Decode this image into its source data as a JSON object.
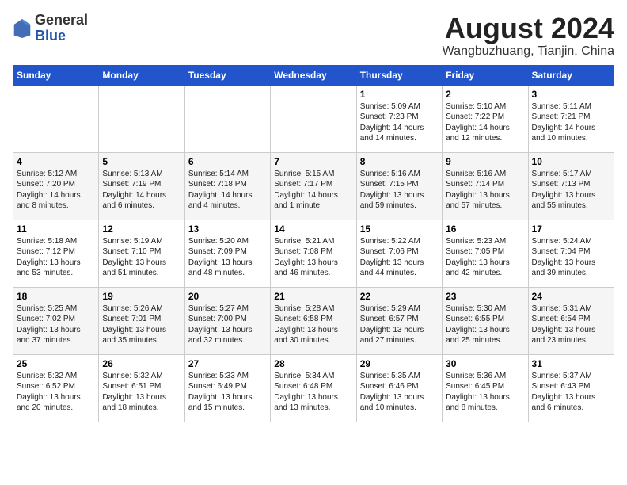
{
  "header": {
    "logo_general": "General",
    "logo_blue": "Blue",
    "month_title": "August 2024",
    "location": "Wangbuzhuang, Tianjin, China"
  },
  "weekdays": [
    "Sunday",
    "Monday",
    "Tuesday",
    "Wednesday",
    "Thursday",
    "Friday",
    "Saturday"
  ],
  "weeks": [
    [
      {
        "day": "",
        "content": ""
      },
      {
        "day": "",
        "content": ""
      },
      {
        "day": "",
        "content": ""
      },
      {
        "day": "",
        "content": ""
      },
      {
        "day": "1",
        "content": "Sunrise: 5:09 AM\nSunset: 7:23 PM\nDaylight: 14 hours\nand 14 minutes."
      },
      {
        "day": "2",
        "content": "Sunrise: 5:10 AM\nSunset: 7:22 PM\nDaylight: 14 hours\nand 12 minutes."
      },
      {
        "day": "3",
        "content": "Sunrise: 5:11 AM\nSunset: 7:21 PM\nDaylight: 14 hours\nand 10 minutes."
      }
    ],
    [
      {
        "day": "4",
        "content": "Sunrise: 5:12 AM\nSunset: 7:20 PM\nDaylight: 14 hours\nand 8 minutes."
      },
      {
        "day": "5",
        "content": "Sunrise: 5:13 AM\nSunset: 7:19 PM\nDaylight: 14 hours\nand 6 minutes."
      },
      {
        "day": "6",
        "content": "Sunrise: 5:14 AM\nSunset: 7:18 PM\nDaylight: 14 hours\nand 4 minutes."
      },
      {
        "day": "7",
        "content": "Sunrise: 5:15 AM\nSunset: 7:17 PM\nDaylight: 14 hours\nand 1 minute."
      },
      {
        "day": "8",
        "content": "Sunrise: 5:16 AM\nSunset: 7:15 PM\nDaylight: 13 hours\nand 59 minutes."
      },
      {
        "day": "9",
        "content": "Sunrise: 5:16 AM\nSunset: 7:14 PM\nDaylight: 13 hours\nand 57 minutes."
      },
      {
        "day": "10",
        "content": "Sunrise: 5:17 AM\nSunset: 7:13 PM\nDaylight: 13 hours\nand 55 minutes."
      }
    ],
    [
      {
        "day": "11",
        "content": "Sunrise: 5:18 AM\nSunset: 7:12 PM\nDaylight: 13 hours\nand 53 minutes."
      },
      {
        "day": "12",
        "content": "Sunrise: 5:19 AM\nSunset: 7:10 PM\nDaylight: 13 hours\nand 51 minutes."
      },
      {
        "day": "13",
        "content": "Sunrise: 5:20 AM\nSunset: 7:09 PM\nDaylight: 13 hours\nand 48 minutes."
      },
      {
        "day": "14",
        "content": "Sunrise: 5:21 AM\nSunset: 7:08 PM\nDaylight: 13 hours\nand 46 minutes."
      },
      {
        "day": "15",
        "content": "Sunrise: 5:22 AM\nSunset: 7:06 PM\nDaylight: 13 hours\nand 44 minutes."
      },
      {
        "day": "16",
        "content": "Sunrise: 5:23 AM\nSunset: 7:05 PM\nDaylight: 13 hours\nand 42 minutes."
      },
      {
        "day": "17",
        "content": "Sunrise: 5:24 AM\nSunset: 7:04 PM\nDaylight: 13 hours\nand 39 minutes."
      }
    ],
    [
      {
        "day": "18",
        "content": "Sunrise: 5:25 AM\nSunset: 7:02 PM\nDaylight: 13 hours\nand 37 minutes."
      },
      {
        "day": "19",
        "content": "Sunrise: 5:26 AM\nSunset: 7:01 PM\nDaylight: 13 hours\nand 35 minutes."
      },
      {
        "day": "20",
        "content": "Sunrise: 5:27 AM\nSunset: 7:00 PM\nDaylight: 13 hours\nand 32 minutes."
      },
      {
        "day": "21",
        "content": "Sunrise: 5:28 AM\nSunset: 6:58 PM\nDaylight: 13 hours\nand 30 minutes."
      },
      {
        "day": "22",
        "content": "Sunrise: 5:29 AM\nSunset: 6:57 PM\nDaylight: 13 hours\nand 27 minutes."
      },
      {
        "day": "23",
        "content": "Sunrise: 5:30 AM\nSunset: 6:55 PM\nDaylight: 13 hours\nand 25 minutes."
      },
      {
        "day": "24",
        "content": "Sunrise: 5:31 AM\nSunset: 6:54 PM\nDaylight: 13 hours\nand 23 minutes."
      }
    ],
    [
      {
        "day": "25",
        "content": "Sunrise: 5:32 AM\nSunset: 6:52 PM\nDaylight: 13 hours\nand 20 minutes."
      },
      {
        "day": "26",
        "content": "Sunrise: 5:32 AM\nSunset: 6:51 PM\nDaylight: 13 hours\nand 18 minutes."
      },
      {
        "day": "27",
        "content": "Sunrise: 5:33 AM\nSunset: 6:49 PM\nDaylight: 13 hours\nand 15 minutes."
      },
      {
        "day": "28",
        "content": "Sunrise: 5:34 AM\nSunset: 6:48 PM\nDaylight: 13 hours\nand 13 minutes."
      },
      {
        "day": "29",
        "content": "Sunrise: 5:35 AM\nSunset: 6:46 PM\nDaylight: 13 hours\nand 10 minutes."
      },
      {
        "day": "30",
        "content": "Sunrise: 5:36 AM\nSunset: 6:45 PM\nDaylight: 13 hours\nand 8 minutes."
      },
      {
        "day": "31",
        "content": "Sunrise: 5:37 AM\nSunset: 6:43 PM\nDaylight: 13 hours\nand 6 minutes."
      }
    ]
  ]
}
